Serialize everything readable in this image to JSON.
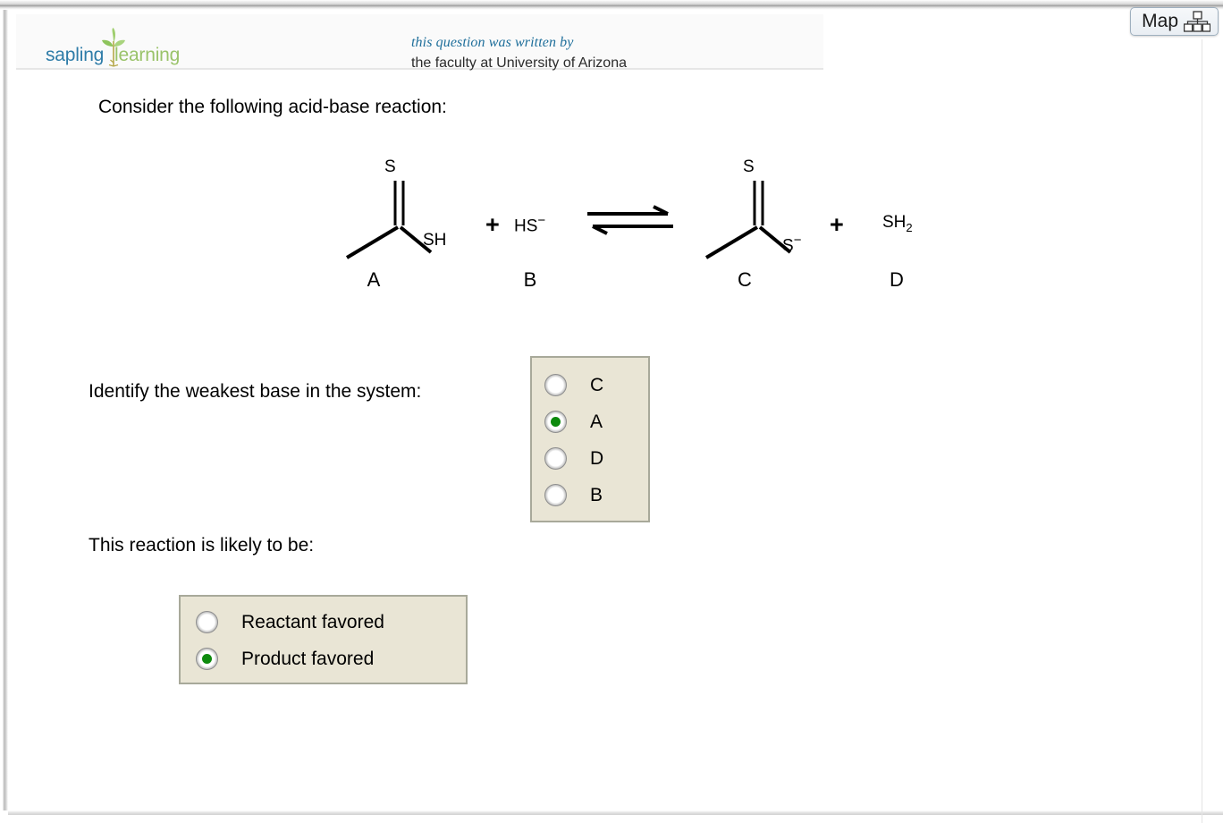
{
  "header": {
    "logo_sapling": "sapling",
    "logo_learning": "learning",
    "logo_icon": "sapling-plant-icon",
    "attribution_line1": "this question was written by",
    "attribution_line2": "the faculty at University of Arizona",
    "map_button_label": "Map",
    "map_button_icon": "sitemap-hierarchy-icon",
    "accent_blue": "#2e7ca8",
    "accent_green": "#9ac36a"
  },
  "question": {
    "prompt_main": "Consider the following acid-base reaction:",
    "prompt_weakest_base": "Identify the weakest base in the system:",
    "prompt_favored": "This reaction is likely to be:"
  },
  "reaction": {
    "arrow_type": "equilibrium-double-arrow",
    "reactants": [
      {
        "id": "A",
        "label": "A",
        "name": "dithioacetic-acid",
        "atoms": [
          {
            "text": "S",
            "role": "double-bonded-sulfur"
          },
          {
            "text": "SH",
            "role": "thiol-group"
          }
        ]
      },
      {
        "id": "B",
        "label": "B",
        "name": "hydrosulfide-anion",
        "formula": "HS",
        "charge": "−"
      }
    ],
    "products": [
      {
        "id": "C",
        "label": "C",
        "name": "dithioacetate-anion",
        "atoms": [
          {
            "text": "S",
            "role": "double-bonded-sulfur"
          },
          {
            "text": "S",
            "role": "thiolate-anion",
            "charge": "−"
          }
        ]
      },
      {
        "id": "D",
        "label": "D",
        "name": "hydrogen-sulfide",
        "formula_main": "SH",
        "formula_sub": "2"
      }
    ],
    "plus_signs": [
      "+",
      "+"
    ]
  },
  "answers": {
    "weakest_base": {
      "selected": "A",
      "options": [
        {
          "value": "C",
          "label": "C",
          "checked": false
        },
        {
          "value": "A",
          "label": "A",
          "checked": true
        },
        {
          "value": "D",
          "label": "D",
          "checked": false
        },
        {
          "value": "B",
          "label": "B",
          "checked": false
        }
      ]
    },
    "favored": {
      "selected": "Product favored",
      "options": [
        {
          "value": "reactant",
          "label": "Reactant favored",
          "checked": false
        },
        {
          "value": "product",
          "label": "Product favored",
          "checked": true
        }
      ]
    },
    "box_background": "#e9e5d5",
    "box_border": "#a8a99a",
    "selected_dot_color": "#0d8a0d"
  }
}
